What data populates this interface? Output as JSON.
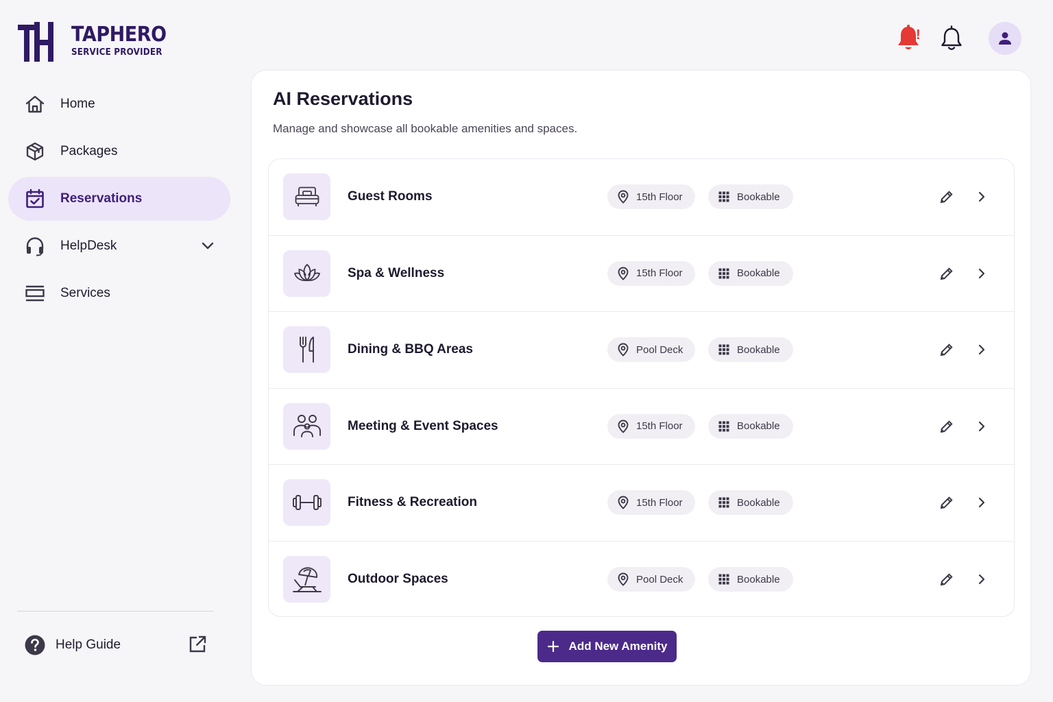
{
  "brand": {
    "name": "TapHero",
    "name_display": "TAPHERO",
    "subtitle": "SERVICE PROVIDER",
    "mark_letters": "TH",
    "color": "#2f1a63"
  },
  "header": {
    "alert_icon": "bell-alert-icon",
    "alert_mark": "!",
    "alert_color": "#e53935",
    "notifications_icon": "bell-icon",
    "profile_icon": "user-icon"
  },
  "sidebar": {
    "items": [
      {
        "label": "Home",
        "icon": "home-icon",
        "active": false
      },
      {
        "label": "Packages",
        "icon": "package-icon",
        "active": false
      },
      {
        "label": "Reservations",
        "icon": "calendar-check-icon",
        "active": true
      },
      {
        "label": "HelpDesk",
        "icon": "headset-icon",
        "active": false,
        "expandable": true
      },
      {
        "label": "Services",
        "icon": "services-icon",
        "active": false
      }
    ],
    "footer": {
      "label": "Help Guide",
      "icon": "help-circle-icon",
      "action_icon": "external-link-icon"
    }
  },
  "main": {
    "title": "AI Reservations",
    "subtitle": "Manage and showcase all bookable amenities and spaces.",
    "amenities": [
      {
        "name": "Guest Rooms",
        "icon": "bed-icon",
        "location": "15th Floor",
        "status": "Bookable"
      },
      {
        "name": "Spa & Wellness",
        "icon": "lotus-icon",
        "location": "15th Floor",
        "status": "Bookable"
      },
      {
        "name": "Dining & BBQ Areas",
        "icon": "utensils-icon",
        "location": "Pool Deck",
        "status": "Bookable"
      },
      {
        "name": "Meeting & Event Spaces",
        "icon": "people-icon",
        "location": "15th Floor",
        "status": "Bookable"
      },
      {
        "name": "Fitness & Recreation",
        "icon": "dumbbell-icon",
        "location": "15th Floor",
        "status": "Bookable"
      },
      {
        "name": "Outdoor Spaces",
        "icon": "beach-chair-icon",
        "location": "Pool Deck",
        "status": "Bookable"
      }
    ],
    "add_button": "Add New Amenity"
  },
  "colors": {
    "accent": "#4b2a8a",
    "active_nav_bg": "#ece4f8",
    "icon_tile_bg": "#efe8f8",
    "chip_bg": "#f1eff4"
  }
}
